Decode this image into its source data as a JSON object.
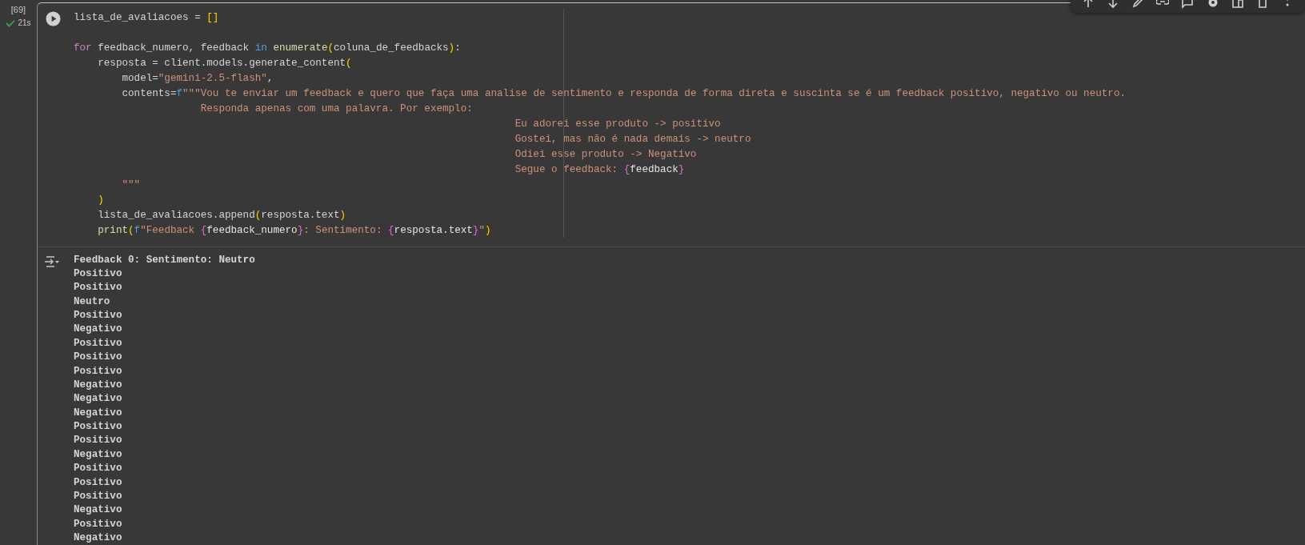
{
  "execution": {
    "count": "[69]",
    "succeeded": true,
    "duration": "21s"
  },
  "code_lines": [
    {
      "kind": "code",
      "tokens": [
        {
          "kind": "plain",
          "text": "lista_de_avaliacoes = "
        },
        {
          "kind": "bracket",
          "text": "[]"
        }
      ]
    },
    {
      "kind": "blank"
    },
    {
      "kind": "code",
      "tokens": [
        {
          "kind": "keyword",
          "text": "for"
        },
        {
          "kind": "plain",
          "text": " feedback_numero, feedback "
        },
        {
          "kind": "operator",
          "text": "in"
        },
        {
          "kind": "function",
          "text": " enumerate"
        },
        {
          "kind": "bracket",
          "text": "("
        },
        {
          "kind": "plain",
          "text": "coluna_de_feedbacks"
        },
        {
          "kind": "bracket",
          "text": ")"
        },
        {
          "kind": "plain",
          "text": ":"
        }
      ]
    },
    {
      "kind": "code",
      "tokens": [
        {
          "kind": "plain",
          "text": "    resposta = client.models.generate_content"
        },
        {
          "kind": "bracket",
          "text": "("
        }
      ]
    },
    {
      "kind": "code",
      "tokens": [
        {
          "kind": "plain",
          "text": "        model="
        },
        {
          "kind": "string",
          "text": "\"gemini-2.5-flash\""
        },
        {
          "kind": "plain",
          "text": ","
        }
      ]
    },
    {
      "kind": "code",
      "tokens": [
        {
          "kind": "plain",
          "text": "        contents="
        },
        {
          "kind": "operator",
          "text": "f"
        },
        {
          "kind": "string",
          "text": "\"\"\"Vou te enviar um feedback e quero que faça uma analise de sentimento e responda de forma direta e suscinta se é um feedback positivo, negativo ou neutro."
        }
      ]
    },
    {
      "kind": "code",
      "tokens": [
        {
          "kind": "string",
          "text": "                     Responda apenas com uma palavra. Por exemplo:"
        }
      ]
    },
    {
      "kind": "code",
      "tokens": [
        {
          "kind": "string",
          "text": "                                                                         Eu adorei esse produto -> positivo"
        }
      ]
    },
    {
      "kind": "code",
      "tokens": [
        {
          "kind": "string",
          "text": "                                                                         Gostei, mas não é nada demais -> neutro"
        }
      ]
    },
    {
      "kind": "code",
      "tokens": [
        {
          "kind": "string",
          "text": "                                                                         Odiei esse produto -> Negativo"
        }
      ]
    },
    {
      "kind": "code",
      "tokens": [
        {
          "kind": "string",
          "text": "                                                                         Segue o feedback: "
        },
        {
          "kind": "brace",
          "text": "{"
        },
        {
          "kind": "variable",
          "text": "feedback"
        },
        {
          "kind": "brace",
          "text": "}"
        }
      ]
    },
    {
      "kind": "code",
      "tokens": [
        {
          "kind": "string",
          "text": "        \"\"\""
        }
      ]
    },
    {
      "kind": "code",
      "tokens": [
        {
          "kind": "bracket",
          "text": "    )"
        }
      ]
    },
    {
      "kind": "code",
      "tokens": [
        {
          "kind": "plain",
          "text": "    lista_de_avaliacoes.append"
        },
        {
          "kind": "bracket",
          "text": "("
        },
        {
          "kind": "plain",
          "text": "resposta.text"
        },
        {
          "kind": "bracket",
          "text": ")"
        }
      ]
    },
    {
      "kind": "code",
      "tokens": [
        {
          "kind": "function",
          "text": "    print"
        },
        {
          "kind": "bracket",
          "text": "("
        },
        {
          "kind": "operator",
          "text": "f"
        },
        {
          "kind": "string",
          "text": "\"Feedback "
        },
        {
          "kind": "brace",
          "text": "{"
        },
        {
          "kind": "variable",
          "text": "feedback_numero"
        },
        {
          "kind": "brace",
          "text": "}"
        },
        {
          "kind": "string",
          "text": ": Sentimento: "
        },
        {
          "kind": "brace",
          "text": "{"
        },
        {
          "kind": "variable",
          "text": "resposta.text"
        },
        {
          "kind": "brace",
          "text": "}"
        },
        {
          "kind": "string",
          "text": "\""
        },
        {
          "kind": "bracket",
          "text": ")"
        }
      ]
    }
  ],
  "output_lines": [
    "Feedback 0: Sentimento: Neutro",
    "Positivo",
    "Positivo",
    "Neutro",
    "Positivo",
    "Negativo",
    "Positivo",
    "Positivo",
    "Positivo",
    "Negativo",
    "Negativo",
    "Negativo",
    "Positivo",
    "Positivo",
    "Negativo",
    "Positivo",
    "Positivo",
    "Positivo",
    "Negativo",
    "Positivo",
    "Negativo"
  ]
}
